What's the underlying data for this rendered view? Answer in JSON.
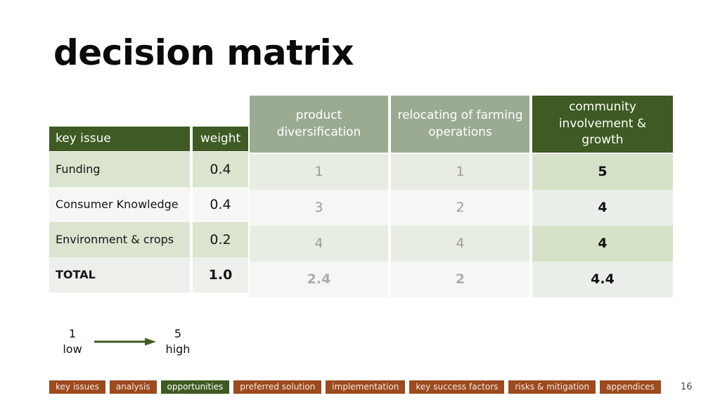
{
  "slide": {
    "title": "decision matrix",
    "page_number": "16"
  },
  "matrix": {
    "headers": {
      "key_issue": "key issue",
      "weight": "weight"
    },
    "options": [
      {
        "label": "product diversification",
        "highlight": false
      },
      {
        "label": "relocating of farming operations",
        "highlight": false
      },
      {
        "label": "community involvement & growth",
        "highlight": true
      }
    ],
    "rows": [
      {
        "issue": "Funding",
        "weight": "0.4",
        "scores": [
          "1",
          "1",
          "5"
        ]
      },
      {
        "issue": "Consumer Knowledge",
        "weight": "0.4",
        "scores": [
          "3",
          "2",
          "4"
        ]
      },
      {
        "issue": "Environment & crops",
        "weight": "0.2",
        "scores": [
          "4",
          "4",
          "4"
        ]
      }
    ],
    "total": {
      "issue": "TOTAL",
      "weight": "1.0",
      "scores": [
        "2.4",
        "2",
        "4.4"
      ]
    }
  },
  "legend": {
    "low_value": "1",
    "low_label": "low",
    "high_value": "5",
    "high_label": "high",
    "arrow_icon": "arrow-right-icon"
  },
  "nav": {
    "tabs": [
      {
        "label": "key issues",
        "active": false
      },
      {
        "label": "analysis",
        "active": false
      },
      {
        "label": "opportunities",
        "active": true
      },
      {
        "label": "preferred solution",
        "active": false
      },
      {
        "label": "implementation",
        "active": false
      },
      {
        "label": "key success factors",
        "active": false
      },
      {
        "label": "risks & mitigation",
        "active": false
      },
      {
        "label": "appendices",
        "active": false
      }
    ]
  },
  "colors": {
    "dark_green": "#3F5A22",
    "sage_green": "#9BAB92",
    "light_green_row": "#DAE4CF",
    "highlight_row": "#D6E2C8",
    "brown_tab": "#9C4A1E"
  }
}
